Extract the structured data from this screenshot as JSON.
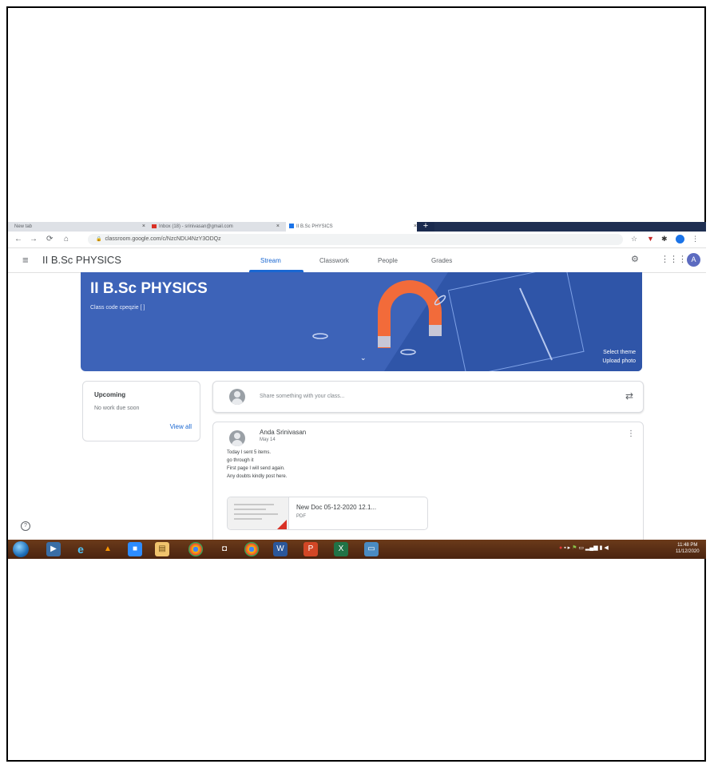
{
  "browser": {
    "tabs": [
      {
        "label": "New tab",
        "active": false
      },
      {
        "label": "Inbox (18) - srinivasan@gmail.com",
        "active": false
      },
      {
        "label": "II B.Sc PHYSICS",
        "active": true
      }
    ],
    "new_tab_label": "+",
    "url": "classroom.google.com/c/NzcNDU4NzY3ODQz"
  },
  "header": {
    "class_name": "II B.Sc PHYSICS",
    "nav_tabs": [
      {
        "label": "Stream",
        "active": true
      },
      {
        "label": "Classwork",
        "active": false
      },
      {
        "label": "People",
        "active": false
      },
      {
        "label": "Grades",
        "active": false
      }
    ],
    "avatar_letter": "A"
  },
  "banner": {
    "title": "II B.Sc PHYSICS",
    "class_code": "Class code cpeqzie [ ]",
    "select_theme": "Select theme",
    "upload_photo": "Upload photo",
    "color": "#3d63b8"
  },
  "upcoming": {
    "title": "Upcoming",
    "text": "No work due soon",
    "view_all": "View all"
  },
  "share": {
    "placeholder": "Share something with your class..."
  },
  "post": {
    "author": "Anda Srinivasan",
    "date": "May 14",
    "body_lines": [
      "Today I sent 5 items.",
      "go through it",
      "First page I will send again.",
      "Any doubts kindly post here."
    ],
    "attachment_name": "New Doc 05-12-2020 12.1...",
    "attachment_type": "PDF"
  },
  "taskbar": {
    "clock_time": "11:48 PM",
    "clock_date": "11/12/2020"
  },
  "colors": {
    "accent": "#1967d2",
    "taskbar": "#5a2e14"
  }
}
